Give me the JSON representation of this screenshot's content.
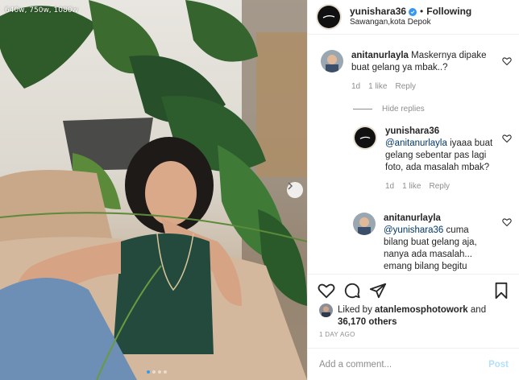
{
  "photo": {
    "watermark": "640w, 750w, 1080w",
    "carousel_dots": 4,
    "active_dot": 1
  },
  "header": {
    "username": "yunishara36",
    "separator": "•",
    "follow_label": "Following",
    "location": "Sawangan,kota Depok"
  },
  "comments": [
    {
      "username": "anitanurlayla",
      "text": "Maskernya dipake buat gelang ya mbak..?",
      "time": "1d",
      "likes": "1 like",
      "reply_label": "Reply"
    },
    {
      "username": "yunishara36",
      "mention": "@anitanurlayla",
      "text": "iyaaa buat gelang sebentar pas lagi foto, ada masalah mbak?",
      "time": "1d",
      "likes": "1 like",
      "reply_label": "Reply"
    },
    {
      "username": "anitanurlayla",
      "mention": "@yunishara36",
      "text": "cuma bilang buat gelang aja, nanya ada masalah... emang bilang begitu"
    }
  ],
  "hide_replies_label": "Hide replies",
  "likes": {
    "prefix": "Liked by",
    "liker": "atanlemosphotowork",
    "and": "and",
    "others": "36,170 others"
  },
  "date": "1 DAY AGO",
  "add_comment": {
    "placeholder": "Add a comment...",
    "post_label": "Post"
  },
  "colors": {
    "accent": "#3897f0",
    "post_disabled": "#b2dffc",
    "secondary_text": "#8e8e8e"
  }
}
